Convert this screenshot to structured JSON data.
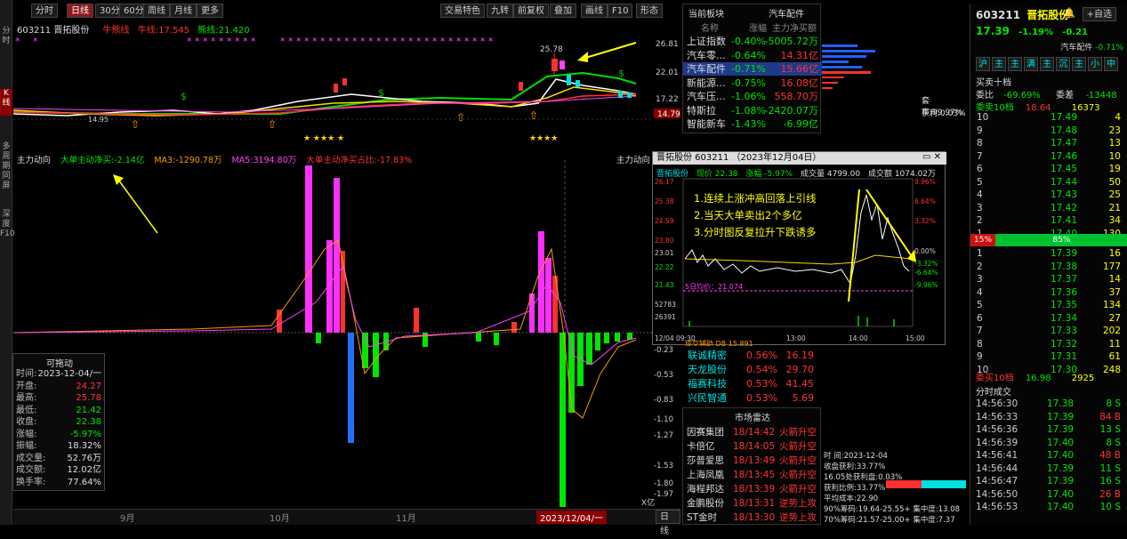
{
  "left_tabs": [
    "分时",
    "K线",
    "多周期同屏",
    "深度F10"
  ],
  "toolbar": {
    "items": [
      "分时",
      "日线",
      "30分",
      "60分",
      "周线",
      "月线",
      "更多"
    ],
    "right_items": [
      "交易特色",
      "九转",
      "前复权",
      "叠加",
      "画线",
      "F10",
      "形态"
    ]
  },
  "kline": {
    "code_name": "603211 晋拓股份",
    "ma_label": "牛熊线",
    "ma1": "牛线:17.545",
    "ma2": "熊线:21.420",
    "price_labels": [
      "26.81",
      "22.01",
      "17.22"
    ],
    "peak_label": "25.78",
    "low_label": "14.95",
    "current_tag": "14.79"
  },
  "indicator": {
    "title": "主力动向",
    "l1": "大单主动净买:-2.14亿",
    "l2": "MA3:-1290.78万",
    "l3": "MA5:3194.80万",
    "l4": "大单主动净买占比:-17.83%",
    "right_title": "主力动向",
    "axis": [
      "-0.23",
      "-0.53",
      "-0.83",
      "-1.10",
      "-1.27",
      "-1.53",
      "-1.80",
      "-1.97"
    ],
    "axis_unit": "X亿",
    "months": [
      "9月",
      "10月",
      "11月"
    ],
    "date_cursor": "2023/12/04/一",
    "right_button": "日线"
  },
  "float_box": {
    "title": "可拖动",
    "rows": [
      {
        "label": "时间:",
        "value": "2023-12-04/一",
        "color": "white"
      },
      {
        "label": "开盘:",
        "value": "24.27",
        "color": "red"
      },
      {
        "label": "最高:",
        "value": "25.78",
        "color": "red"
      },
      {
        "label": "最低:",
        "value": "21.42",
        "color": "green"
      },
      {
        "label": "收盘:",
        "value": "22.38",
        "color": "green"
      },
      {
        "label": "涨幅:",
        "value": "-5.97%",
        "color": "green"
      },
      {
        "label": "振幅:",
        "value": "18.32%",
        "color": "white"
      },
      {
        "label": "成交量:",
        "value": "52.76万",
        "color": "white"
      },
      {
        "label": "成交额:",
        "value": "12.02亿",
        "color": "white"
      },
      {
        "label": "换手率:",
        "value": "77.64%",
        "color": "white"
      }
    ]
  },
  "sector_panel": {
    "title": "当前板块",
    "title_right": "汽车配件",
    "headers": [
      "名称",
      "涨幅",
      "主力净买额"
    ],
    "rows": [
      {
        "name": "上证指数",
        "chg": "-0.40%",
        "amt": "-5005.72万",
        "amt_color": "green"
      },
      {
        "name": "汽车零...",
        "chg": "-0.64%",
        "amt": "14.31亿",
        "amt_color": "red"
      },
      {
        "name": "汽车配件",
        "chg": "-0.71%",
        "amt": "15.66亿",
        "amt_color": "red"
      },
      {
        "name": "新能源...",
        "chg": "-0.75%",
        "amt": "16.08亿",
        "amt_color": "red"
      },
      {
        "name": "汽车压...",
        "chg": "-1.06%",
        "amt": "558.70万",
        "amt_color": "red"
      },
      {
        "name": "特斯拉",
        "chg": "-1.08%",
        "amt": "-2420.07万",
        "amt_color": "green"
      },
      {
        "name": "智能新车",
        "chg": "-1.43%",
        "amt": "-6.99亿",
        "amt_color": "green"
      }
    ]
  },
  "popup": {
    "title": "晋拓股份 603211 （2023年12月04日）",
    "subheader": {
      "name": "晋拓股份",
      "price": "现价 22.38",
      "chg": "涨幅 -5.97%",
      "vol": "成交量 4799.00",
      "amount": "成交额 1074.02万"
    },
    "left_axis": [
      "26.17",
      "25.38",
      "24.59",
      "23.80",
      "23.01",
      "22.22",
      "21.43",
      "52783",
      "26391"
    ],
    "right_axis": [
      "9.96%",
      "6.64%",
      "3.32%",
      "0.00%",
      "-3.32%",
      "-6.64%",
      "-9.96%"
    ],
    "avg_label": "5日均价：21.074",
    "time_axis": [
      "12/04 09:30",
      "13:00",
      "14:00",
      "15:00"
    ],
    "notes": [
      "1.连续上涨冲高回落上引线",
      "2.当天大单卖出2个多亿",
      "3.分时图反复拉升下跌诱多"
    ],
    "bottom_label": "成交辅助 DB 15.891"
  },
  "lower_list": [
    {
      "name": "联诚精密",
      "chg": "0.56%",
      "val": "16.19"
    },
    {
      "name": "天龙股份",
      "chg": "0.54%",
      "val": "29.70"
    },
    {
      "name": "福赛科技",
      "chg": "0.53%",
      "val": "41.45"
    },
    {
      "name": "兴民智通",
      "chg": "0.53%",
      "val": "5.69"
    }
  ],
  "radar": {
    "title": "市场雷达",
    "rows": [
      {
        "name": "因赛集团",
        "time": "18/14:42",
        "event": "火箭升空"
      },
      {
        "name": "卡倍亿",
        "time": "18/14:05",
        "event": "火箭升空"
      },
      {
        "name": "莎普爱思",
        "time": "18/13:49",
        "event": "火箭升空"
      },
      {
        "name": "上海凤凰",
        "time": "18/13:45",
        "event": "火箭升空"
      },
      {
        "name": "海程邦达",
        "time": "18/13:39",
        "event": "火箭升空"
      },
      {
        "name": "金鹏股份",
        "time": "18/13:31",
        "event": "逆势上攻"
      },
      {
        "name": "ST金时",
        "time": "18/13:30",
        "event": "逆势上攻"
      }
    ]
  },
  "chip": {
    "profit_ratio": "套牢:99.97%",
    "gain_ratio": "获利:0.03%",
    "date": "时    间:2023-12-04",
    "lines": [
      "收盘获利:33.77%",
      "16.05处获利盘:0.03%",
      "获利比例:33.77%",
      "平均成本:22.90",
      "90%筹码:19.64-25.55+  集中度:13.08",
      "70%筹码:21.57-25.00+  集中度:7.37"
    ]
  },
  "right_panel": {
    "code": "603211",
    "name": "晋拓股份",
    "add_btn": "+自选",
    "price": "17.39",
    "chg": "-1.19%",
    "chg_amt": "-0.21",
    "sector_label": "汽车配件",
    "sector_chg": "-0.71%",
    "tabs": [
      "沪",
      "主",
      "主",
      "满",
      "主",
      "沉",
      "主",
      "小",
      "中"
    ],
    "ob_title": "买卖十档",
    "ratio_label": "委比",
    "ratio": "-69.69%",
    "diff_label": "委差",
    "diff": "-13448",
    "sell10_label": "委卖10档",
    "sell10_price": "18.64",
    "sell10_vol": "16373",
    "sells": [
      {
        "lvl": "10",
        "price": "17.49",
        "vol": "4"
      },
      {
        "lvl": "9",
        "price": "17.48",
        "vol": "23"
      },
      {
        "lvl": "8",
        "price": "17.47",
        "vol": "13"
      },
      {
        "lvl": "7",
        "price": "17.46",
        "vol": "10"
      },
      {
        "lvl": "6",
        "price": "17.45",
        "vol": "19"
      },
      {
        "lvl": "5",
        "price": "17.44",
        "vol": "50"
      },
      {
        "lvl": "4",
        "price": "17.43",
        "vol": "25"
      },
      {
        "lvl": "3",
        "price": "17.42",
        "vol": "21"
      },
      {
        "lvl": "2",
        "price": "17.41",
        "vol": "34"
      },
      {
        "lvl": "1",
        "price": "17.40",
        "vol": "130"
      }
    ],
    "bar_left": "15%",
    "bar_right": "85%",
    "buys": [
      {
        "lvl": "1",
        "price": "17.39",
        "vol": "16"
      },
      {
        "lvl": "2",
        "price": "17.38",
        "vol": "177"
      },
      {
        "lvl": "3",
        "price": "17.37",
        "vol": "14"
      },
      {
        "lvl": "4",
        "price": "17.36",
        "vol": "37"
      },
      {
        "lvl": "5",
        "price": "17.35",
        "vol": "134"
      },
      {
        "lvl": "6",
        "price": "17.34",
        "vol": "27"
      },
      {
        "lvl": "7",
        "price": "17.33",
        "vol": "202"
      },
      {
        "lvl": "8",
        "price": "17.32",
        "vol": "11"
      },
      {
        "lvl": "9",
        "price": "17.31",
        "vol": "61"
      },
      {
        "lvl": "10",
        "price": "17.30",
        "vol": "248"
      }
    ],
    "buy10_label": "委买10档",
    "buy10_price": "16.98",
    "buy10_vol": "2925",
    "trades_title": "分时成交",
    "trades": [
      {
        "time": "14:56:30",
        "price": "17.38",
        "vol": "8 S",
        "vc": "green"
      },
      {
        "time": "14:56:33",
        "price": "17.39",
        "vol": "84 B",
        "vc": "red"
      },
      {
        "time": "14:56:36",
        "price": "17.39",
        "vol": "13 S",
        "vc": "green"
      },
      {
        "time": "14:56:39",
        "price": "17.40",
        "vol": "8 S",
        "vc": "green"
      },
      {
        "time": "14:56:41",
        "price": "17.40",
        "vol": "48 B",
        "vc": "red"
      },
      {
        "time": "14:56:44",
        "price": "17.39",
        "vol": "11 S",
        "vc": "green"
      },
      {
        "time": "14:56:47",
        "price": "17.39",
        "vol": "16 S",
        "vc": "green"
      },
      {
        "time": "14:56:50",
        "price": "17.40",
        "vol": "26 B",
        "vc": "red"
      },
      {
        "time": "14:56:53",
        "price": "17.40",
        "vol": "10 S",
        "vc": "green"
      }
    ]
  }
}
